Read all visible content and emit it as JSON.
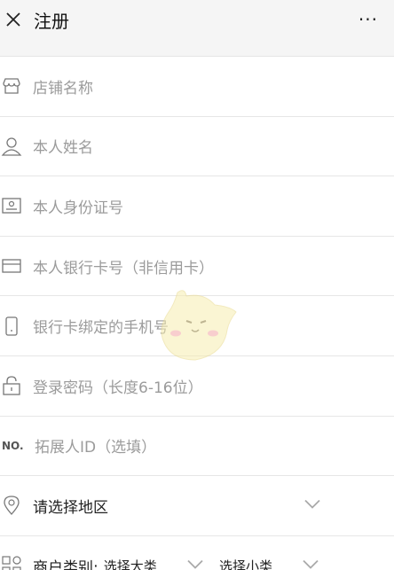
{
  "header": {
    "title": "注册",
    "more_label": "···"
  },
  "form": {
    "store_name_placeholder": "店铺名称",
    "owner_name_placeholder": "本人姓名",
    "id_card_placeholder": "本人身份证号",
    "bank_card_placeholder": "本人银行卡号（非信用卡）",
    "bank_phone_placeholder": "银行卡绑定的手机号",
    "password_placeholder": "登录密码（长度6-16位）",
    "referrer_no_label": "NO.",
    "referrer_placeholder": "拓展人ID（选填）",
    "region_label": "请选择地区",
    "category_label": "商户类别:",
    "category_major": "选择大类",
    "category_minor": "选择小类"
  },
  "colors": {
    "header_bg": "#f5f5f5",
    "placeholder": "#9b9b9b",
    "divider": "#e6e6e6"
  }
}
